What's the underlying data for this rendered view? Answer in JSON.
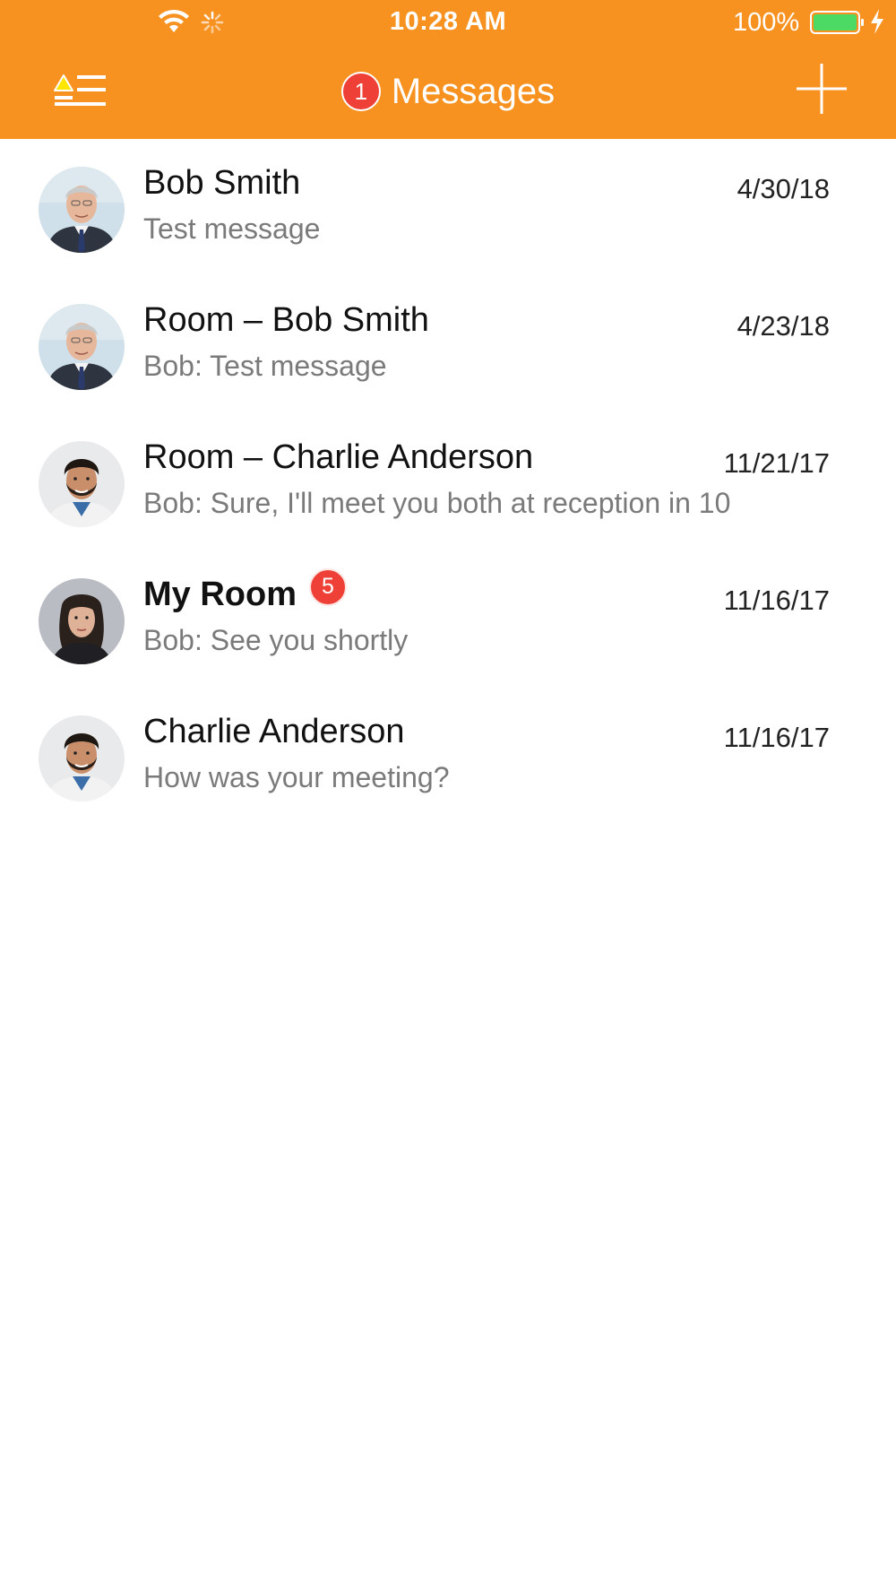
{
  "status_bar": {
    "time": "10:28 AM",
    "battery_percent": "100%",
    "wifi_icon": "wifi-icon",
    "activity_icon": "spinner-icon",
    "battery_icon": "battery-icon",
    "charging_icon": "bolt-icon"
  },
  "header": {
    "title": "Messages",
    "badge_count": "1",
    "menu_icon": "menu-icon",
    "add_icon": "plus-icon",
    "background_color": "#f7911f"
  },
  "conversations": [
    {
      "name": "Bob Smith",
      "preview": "Test message",
      "date": "4/30/18",
      "avatar": "bob",
      "unread": ""
    },
    {
      "name": "Room – Bob Smith",
      "preview": "Bob: Test message",
      "date": "4/23/18",
      "avatar": "bob",
      "unread": ""
    },
    {
      "name": "Room – Charlie Anderson",
      "preview": "Bob: Sure, I'll meet you both at reception in 10",
      "date": "11/21/17",
      "avatar": "charlie",
      "unread": ""
    },
    {
      "name": "My Room",
      "preview": "Bob: See you shortly",
      "date": "11/16/17",
      "avatar": "woman",
      "unread": "5"
    },
    {
      "name": "Charlie Anderson",
      "preview": "How was your meeting?",
      "date": "11/16/17",
      "avatar": "charlie",
      "unread": ""
    }
  ],
  "colors": {
    "accent": "#f7911f",
    "badge": "#ee4036"
  }
}
